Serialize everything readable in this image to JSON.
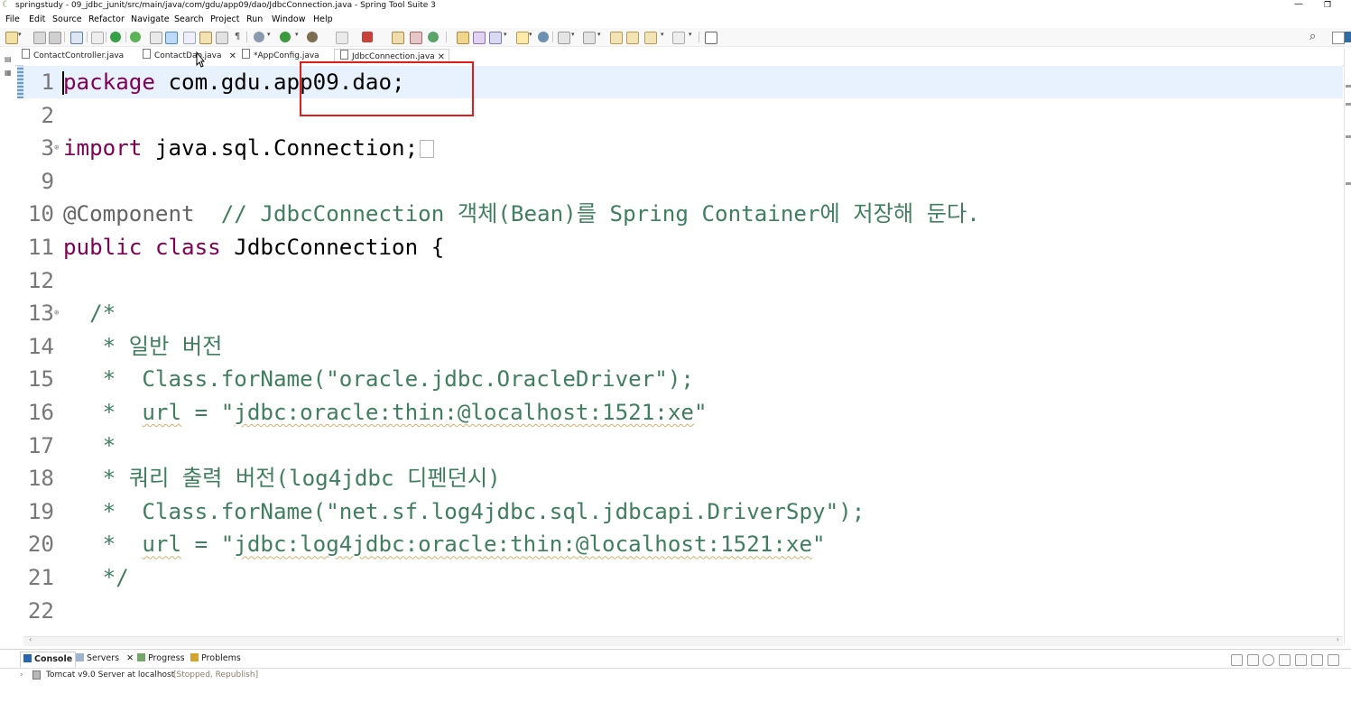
{
  "window": {
    "title": "springstudy - 09_jdbc_junit/src/main/java/com/gdu/app09/dao/JdbcConnection.java - Spring Tool Suite 3",
    "min_glyph": "—",
    "restore_glyph": "❐"
  },
  "menu": [
    "File",
    "Edit",
    "Source",
    "Refactor",
    "Navigate",
    "Search",
    "Project",
    "Run",
    "Window",
    "Help"
  ],
  "tabs": [
    {
      "label": "ContactController.java",
      "closable": false,
      "active": false
    },
    {
      "label": "ContactDao.java",
      "closable": true,
      "active": false
    },
    {
      "label": "*AppConfig.java",
      "closable": false,
      "active": false
    },
    {
      "label": "JdbcConnection.java",
      "closable": true,
      "active": true
    }
  ],
  "editor": {
    "lines": [
      {
        "n": "1",
        "tokens": [
          {
            "t": "package",
            "c": "kw"
          },
          {
            "t": " com.gdu.app09.dao;",
            "c": "txt"
          }
        ]
      },
      {
        "n": "2",
        "tokens": []
      },
      {
        "n": "3",
        "fold": true,
        "tokens": [
          {
            "t": "import",
            "c": "kw"
          },
          {
            "t": " java.sql.Connection;",
            "c": "txt"
          }
        ]
      },
      {
        "n": "9",
        "tokens": []
      },
      {
        "n": "10",
        "tokens": [
          {
            "t": "@Component",
            "c": "ann"
          },
          {
            "t": "  // JdbcConnection 객체(Bean)를 Spring Container에 저장해 둔다.",
            "c": "cm"
          }
        ]
      },
      {
        "n": "11",
        "tokens": [
          {
            "t": "public",
            "c": "kw"
          },
          {
            "t": " ",
            "c": "txt"
          },
          {
            "t": "class",
            "c": "kw"
          },
          {
            "t": " JdbcConnection {",
            "c": "txt"
          }
        ]
      },
      {
        "n": "12",
        "tokens": []
      },
      {
        "n": "13",
        "fold": true,
        "tokens": [
          {
            "t": "  /*",
            "c": "cm"
          }
        ]
      },
      {
        "n": "14",
        "tokens": [
          {
            "t": "   * 일반 버전",
            "c": "cm"
          }
        ]
      },
      {
        "n": "15",
        "tokens": [
          {
            "t": "   *  Class.forName(\"oracle.jdbc.OracleDriver\");",
            "c": "cm"
          }
        ]
      },
      {
        "n": "16",
        "tokens": [
          {
            "t": "   *  ",
            "c": "cm"
          },
          {
            "t": "url",
            "c": "cm sq"
          },
          {
            "t": " = \"",
            "c": "cm"
          },
          {
            "t": "jdbc:oracle:thin:@localhost:1521:xe",
            "c": "cm sq"
          },
          {
            "t": "\"",
            "c": "cm"
          }
        ]
      },
      {
        "n": "17",
        "tokens": [
          {
            "t": "   *",
            "c": "cm"
          }
        ]
      },
      {
        "n": "18",
        "tokens": [
          {
            "t": "   * 쿼리 출력 버전(log4jdbc 디펜던시)",
            "c": "cm"
          }
        ]
      },
      {
        "n": "19",
        "tokens": [
          {
            "t": "   *  Class.forName(\"net.sf.log4jdbc.sql.jdbcapi.DriverSpy\");",
            "c": "cm"
          }
        ]
      },
      {
        "n": "20",
        "tokens": [
          {
            "t": "   *  ",
            "c": "cm"
          },
          {
            "t": "url",
            "c": "cm sq"
          },
          {
            "t": " = \"",
            "c": "cm"
          },
          {
            "t": "jdbc:log4jdbc:oracle:thin:@localhost:1521:xe",
            "c": "cm sq"
          },
          {
            "t": "\"",
            "c": "cm"
          }
        ]
      },
      {
        "n": "21",
        "tokens": [
          {
            "t": "   */",
            "c": "cm"
          }
        ]
      },
      {
        "n": "22",
        "tokens": []
      }
    ]
  },
  "bottom_panel": {
    "tabs": [
      {
        "label": "Console",
        "active": true
      },
      {
        "label": "Servers",
        "active": false,
        "closable": true
      },
      {
        "label": "Progress",
        "active": false
      },
      {
        "label": "Problems",
        "active": false
      }
    ],
    "server_name": "Tomcat v9.0 Server at localhost",
    "server_state": "[Stopped, Republish]"
  },
  "colors": {
    "keyword": "#7f0055",
    "comment": "#3f7f5f",
    "highlight_box": "#e21b1b",
    "current_line": "#e8f2fe"
  }
}
